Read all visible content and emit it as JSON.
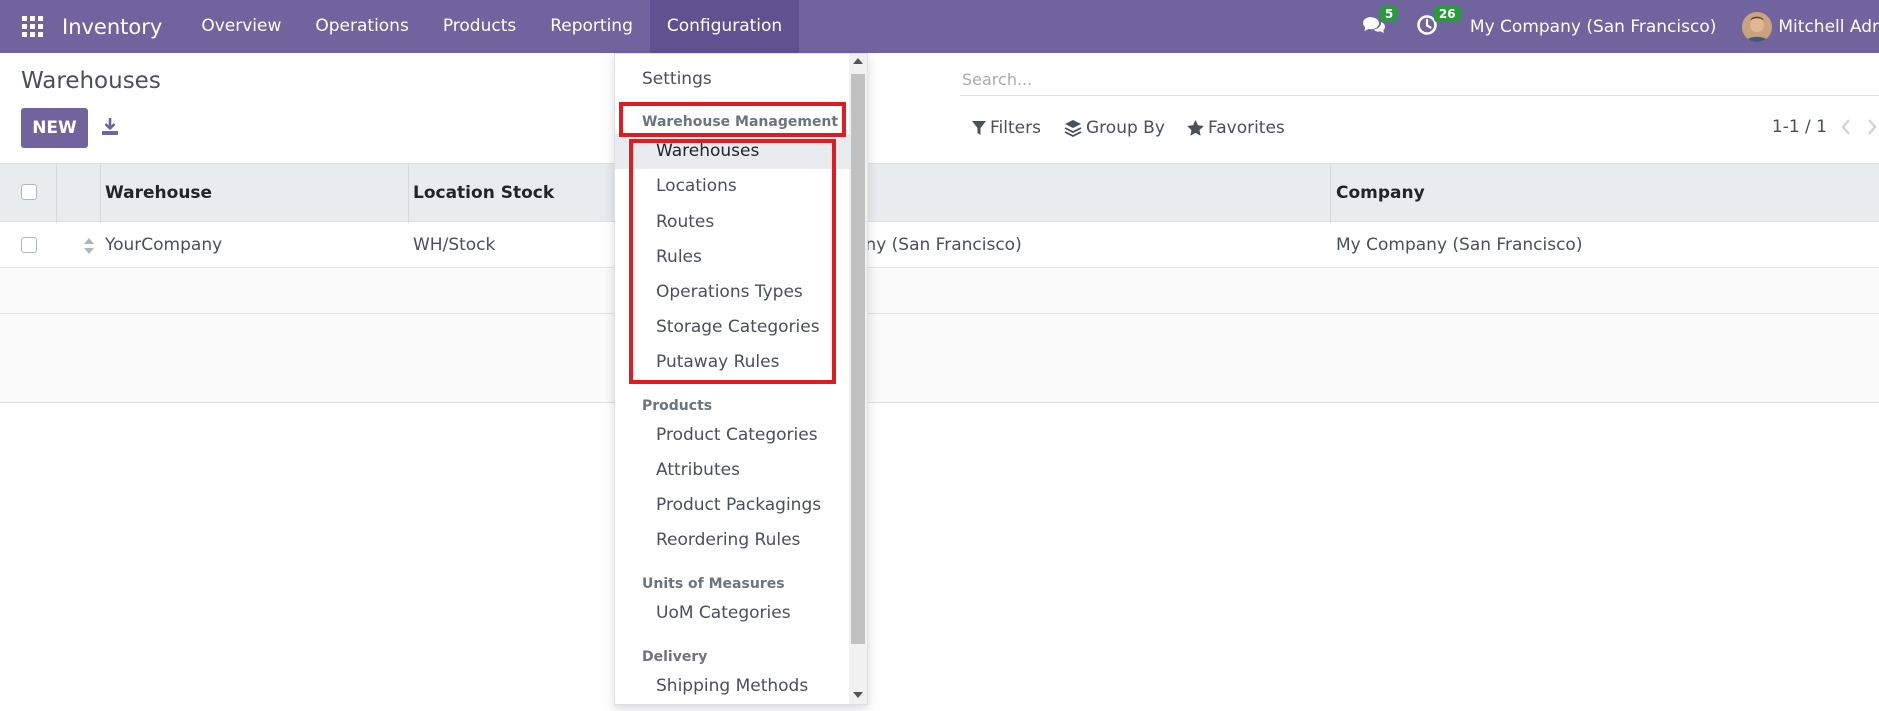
{
  "navbar": {
    "brand": "Inventory",
    "menu": [
      "Overview",
      "Operations",
      "Products",
      "Reporting",
      "Configuration"
    ],
    "messages_count": "5",
    "activities_count": "26",
    "company": "My Company (San Francisco)",
    "user": "Mitchell Adr",
    "bg_color": "#71639e"
  },
  "page": {
    "title": "Warehouses",
    "new_label": "NEW"
  },
  "search": {
    "placeholder": "Search..."
  },
  "filters": {
    "filters_label": "Filters",
    "groupby_label": "Group By",
    "favorites_label": "Favorites"
  },
  "pager": {
    "text": "1-1 / 1"
  },
  "table": {
    "headers": [
      "Warehouse",
      "Location Stock",
      "Company"
    ],
    "rows": [
      {
        "warehouse": "YourCompany",
        "location": "WH/Stock",
        "address": "any (San Francisco)",
        "company": "My Company (San Francisco)"
      }
    ]
  },
  "dropdown": {
    "settings": "Settings",
    "section_warehouse": "Warehouse Management",
    "warehouse_items": [
      "Warehouses",
      "Locations",
      "Routes",
      "Rules",
      "Operations Types",
      "Storage Categories",
      "Putaway Rules"
    ],
    "section_products": "Products",
    "product_items": [
      "Product Categories",
      "Attributes",
      "Product Packagings",
      "Reordering Rules"
    ],
    "section_uom": "Units of Measures",
    "uom_items": [
      "UoM Categories"
    ],
    "section_delivery": "Delivery",
    "delivery_items": [
      "Shipping Methods"
    ]
  },
  "colors": {
    "highlight": "#e11b22",
    "badge": "#2b9a3e"
  }
}
